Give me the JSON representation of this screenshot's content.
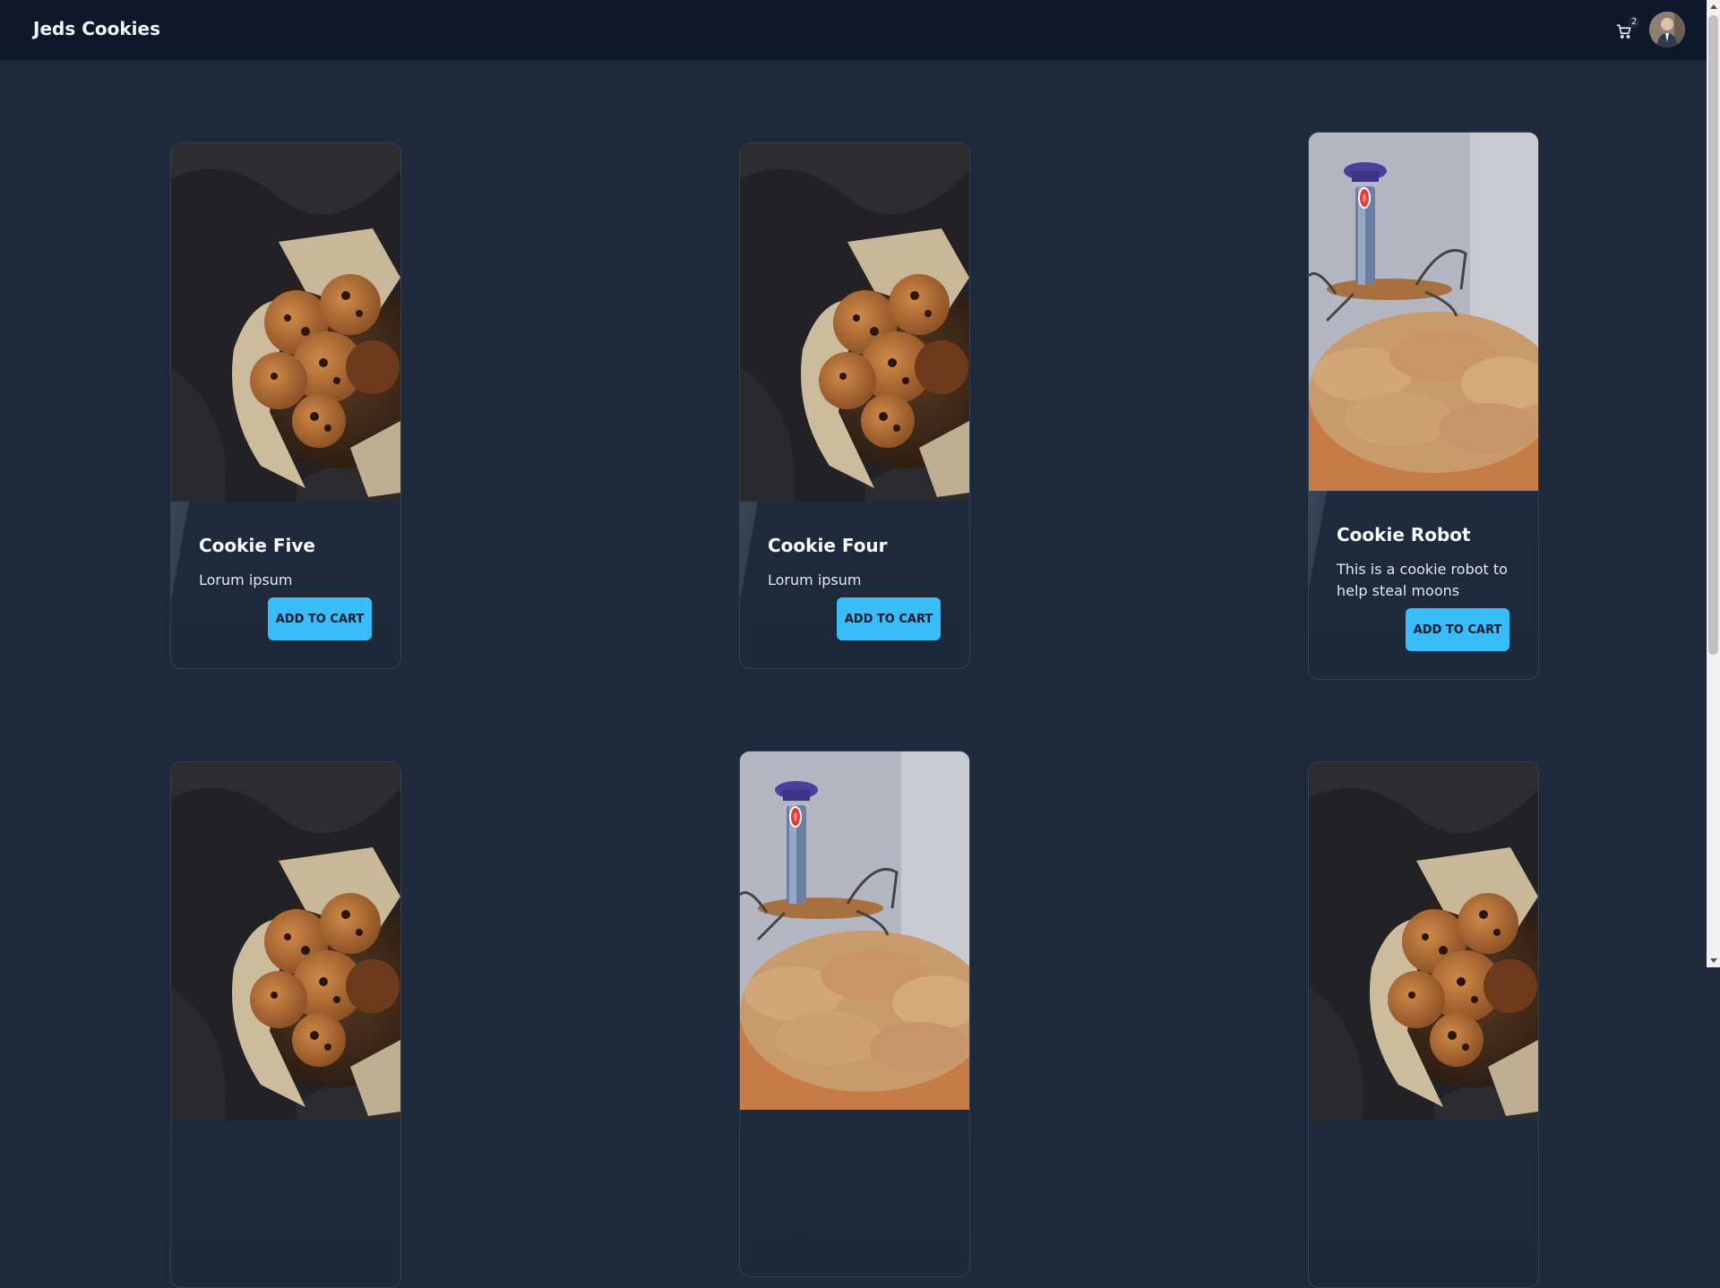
{
  "navbar": {
    "brand": "Jeds Cookies",
    "cart_count": "2"
  },
  "products": [
    {
      "name": "Cookie Five",
      "description": "Lorum ipsum",
      "button_label": "ADD TO CART",
      "image": "cookie-bowl"
    },
    {
      "name": "Cookie Four",
      "description": "Lorum ipsum",
      "button_label": "ADD TO CART",
      "image": "cookie-bowl"
    },
    {
      "name": "Cookie Robot",
      "description": "This is a cookie robot to help steal moons",
      "button_label": "ADD TO CART",
      "image": "cookie-robot"
    },
    {
      "image": "cookie-bowl"
    },
    {
      "image": "cookie-robot"
    },
    {
      "image": "cookie-bowl"
    }
  ],
  "colors": {
    "navbar_bg": "#0f172a",
    "page_bg": "#1e293b",
    "button_bg": "#38bdf8",
    "card_border": "#334155"
  },
  "icons": {
    "cart": "shopping-cart-icon",
    "avatar": "user-avatar"
  }
}
